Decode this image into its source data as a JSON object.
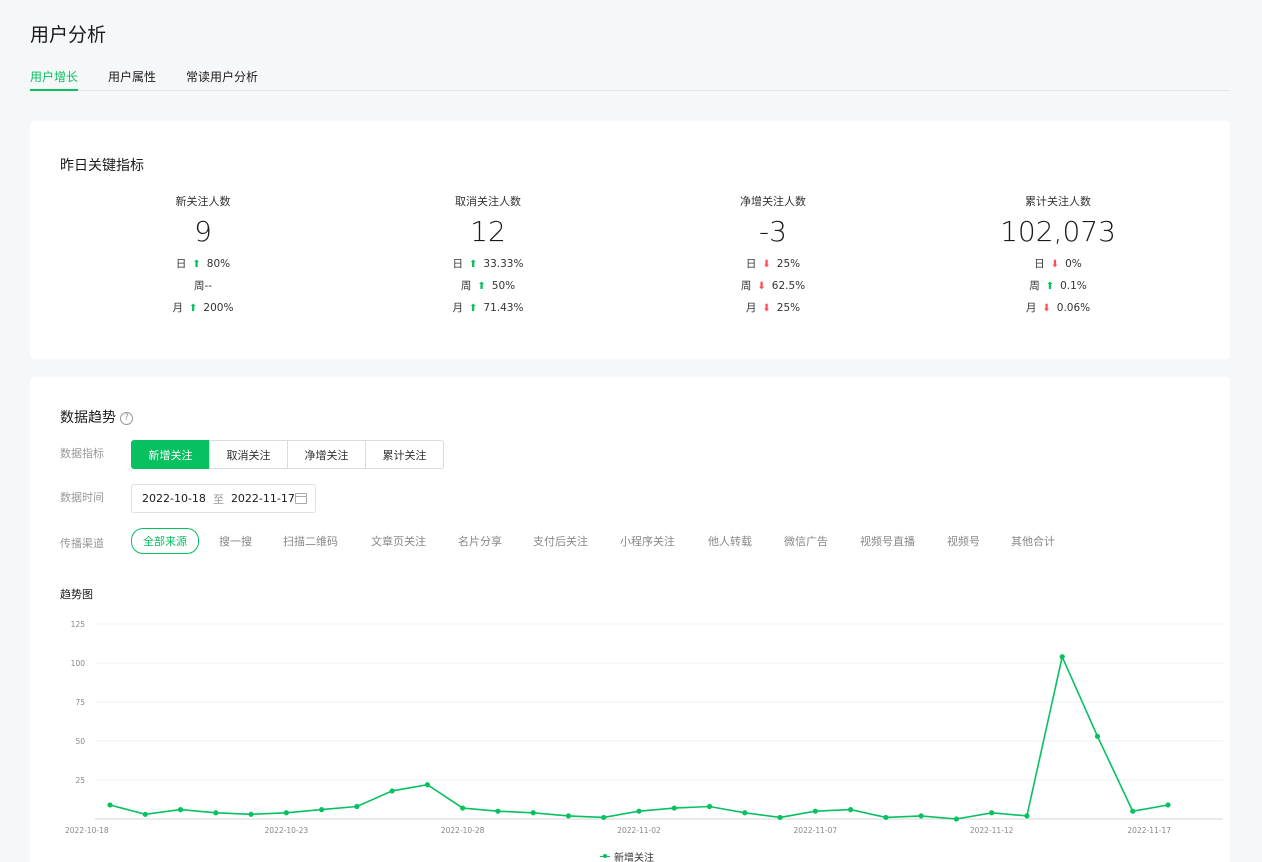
{
  "page": {
    "title": "用户分析"
  },
  "tabs": [
    {
      "label": "用户增长",
      "active": true
    },
    {
      "label": "用户属性",
      "active": false
    },
    {
      "label": "常读用户分析",
      "active": false
    }
  ],
  "key_metrics": {
    "title": "昨日关键指标",
    "items": [
      {
        "label": "新关注人数",
        "value": "9",
        "rows": [
          {
            "period": "日",
            "dir": "up",
            "change": "80%"
          },
          {
            "period": "周--",
            "dir": "",
            "change": ""
          },
          {
            "period": "月",
            "dir": "up",
            "change": "200%"
          }
        ]
      },
      {
        "label": "取消关注人数",
        "value": "12",
        "rows": [
          {
            "period": "日",
            "dir": "up",
            "change": "33.33%"
          },
          {
            "period": "周",
            "dir": "up",
            "change": "50%"
          },
          {
            "period": "月",
            "dir": "up",
            "change": "71.43%"
          }
        ]
      },
      {
        "label": "净增关注人数",
        "value": "-3",
        "rows": [
          {
            "period": "日",
            "dir": "down",
            "change": "25%"
          },
          {
            "period": "周",
            "dir": "down",
            "change": "62.5%"
          },
          {
            "period": "月",
            "dir": "down",
            "change": "25%"
          }
        ]
      },
      {
        "label": "累计关注人数",
        "value": "102,073",
        "rows": [
          {
            "period": "日",
            "dir": "down",
            "change": "0%"
          },
          {
            "period": "周",
            "dir": "up",
            "change": "0.1%"
          },
          {
            "period": "月",
            "dir": "down",
            "change": "0.06%"
          }
        ]
      }
    ]
  },
  "trend": {
    "title": "数据趋势",
    "help_icon": "question-circle-icon",
    "metric_label": "数据指标",
    "metric_buttons": [
      {
        "label": "新增关注",
        "active": true
      },
      {
        "label": "取消关注",
        "active": false
      },
      {
        "label": "净增关注",
        "active": false
      },
      {
        "label": "累计关注",
        "active": false
      }
    ],
    "time_label": "数据时间",
    "date_start": "2022-10-18",
    "date_sep": "至",
    "date_end": "2022-11-17",
    "channel_label": "传播渠道",
    "channels": [
      {
        "label": "全部来源",
        "active": true
      },
      {
        "label": "搜一搜",
        "active": false
      },
      {
        "label": "扫描二维码",
        "active": false
      },
      {
        "label": "文章页关注",
        "active": false
      },
      {
        "label": "名片分享",
        "active": false
      },
      {
        "label": "支付后关注",
        "active": false
      },
      {
        "label": "小程序关注",
        "active": false
      },
      {
        "label": "他人转载",
        "active": false
      },
      {
        "label": "微信广告",
        "active": false
      },
      {
        "label": "视频号直播",
        "active": false
      },
      {
        "label": "视频号",
        "active": false
      },
      {
        "label": "其他合计",
        "active": false
      }
    ],
    "chart_title": "趋势图"
  },
  "colors": {
    "accent": "#07c160",
    "down": "#fa5151"
  },
  "chart_data": {
    "type": "line",
    "x": [
      "2022-10-18",
      "2022-10-19",
      "2022-10-20",
      "2022-10-21",
      "2022-10-22",
      "2022-10-23",
      "2022-10-24",
      "2022-10-25",
      "2022-10-26",
      "2022-10-27",
      "2022-10-28",
      "2022-10-29",
      "2022-10-30",
      "2022-10-31",
      "2022-11-01",
      "2022-11-02",
      "2022-11-03",
      "2022-11-04",
      "2022-11-05",
      "2022-11-06",
      "2022-11-07",
      "2022-11-08",
      "2022-11-09",
      "2022-11-10",
      "2022-11-11",
      "2022-11-12",
      "2022-11-13",
      "2022-11-14",
      "2022-11-15",
      "2022-11-16",
      "2022-11-17"
    ],
    "xticks": [
      "2022-10-18",
      "2022-10-23",
      "2022-10-28",
      "2022-11-02",
      "2022-11-07",
      "2022-11-12",
      "2022-11-17"
    ],
    "series": [
      {
        "name": "新增关注",
        "values": [
          9,
          3,
          6,
          4,
          3,
          4,
          6,
          8,
          18,
          22,
          7,
          5,
          4,
          2,
          1,
          5,
          7,
          8,
          4,
          1,
          5,
          6,
          1,
          2,
          0,
          4,
          2,
          104,
          53,
          5,
          9
        ]
      }
    ],
    "yticks": [
      25,
      50,
      75,
      100,
      125
    ],
    "ylim": [
      0,
      125
    ],
    "grid": true,
    "legend": "bottom-center"
  }
}
